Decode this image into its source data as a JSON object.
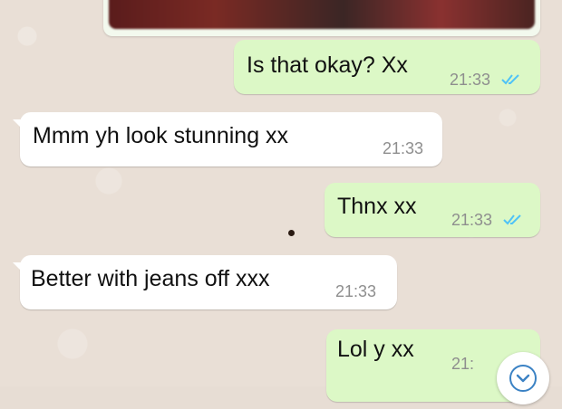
{
  "messages": [
    {
      "direction": "out",
      "text": "Is that okay? Xx",
      "time": "21:33",
      "status": "read"
    },
    {
      "direction": "in",
      "text": "Mmm yh look stunning xx",
      "time": "21:33"
    },
    {
      "direction": "out",
      "text": "Thnx xx",
      "time": "21:33",
      "status": "read"
    },
    {
      "direction": "in",
      "text": "Better with jeans off xxx",
      "time": "21:33"
    },
    {
      "direction": "out",
      "text": "Lol y xx",
      "time": "21:",
      "status": "read"
    }
  ],
  "colors": {
    "outgoing_bubble": "#dcf8c6",
    "incoming_bubble": "#ffffff",
    "read_ticks": "#4fc3f7",
    "background": "#e9dfd6"
  },
  "icons": {
    "read_receipt": "double-check-icon",
    "scroll_down": "chevron-down-icon"
  }
}
